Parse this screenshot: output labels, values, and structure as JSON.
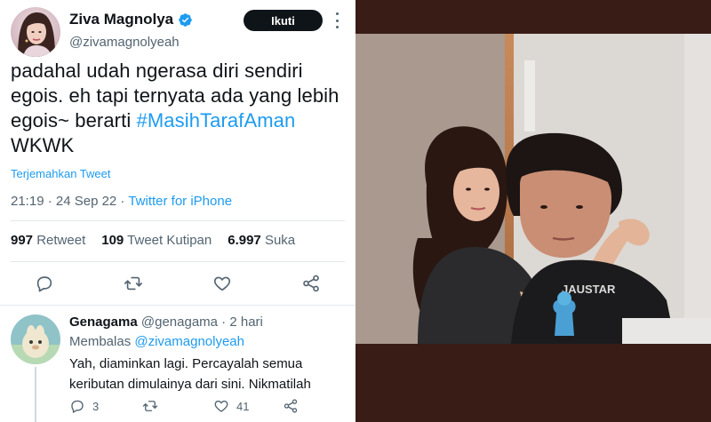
{
  "tweet": {
    "author": {
      "display_name": "Ziva Magnolya",
      "handle": "@zivamagnolyeah",
      "verified": true
    },
    "follow_label": "Ikuti",
    "text_parts": {
      "line1": "padahal udah ngerasa diri sendiri",
      "line2": "egois. eh tapi ternyata ada yang lebih",
      "line3_prefix": "egois~ berarti ",
      "hashtag": "#MasihTarafAman",
      "line4": "WKWK"
    },
    "translate_label": "Terjemahkan Tweet",
    "timestamp": "21:19 · 24 Sep 22 · ",
    "source": "Twitter for iPhone",
    "stats": {
      "retweets_count": "997",
      "retweets_label": "Retweet",
      "quotes_count": "109",
      "quotes_label": "Tweet Kutipan",
      "likes_count": "6.997",
      "likes_label": "Suka"
    },
    "actions": [
      "reply-icon",
      "retweet-icon",
      "like-icon",
      "share-icon"
    ]
  },
  "reply": {
    "display_name": "Genagama",
    "handle": "@genagama",
    "separator": " · ",
    "time": "2 hari",
    "replying_label": "Membalas ",
    "replying_to": "@zivamagnolyeah",
    "text": "Yah, diaminkan lagi. Percayalah semua keributan dimulainya dari sini. Nikmatilah",
    "reply_count": "3",
    "retweet_count": "",
    "like_count": "41"
  },
  "colors": {
    "accent": "#1d9bf0",
    "text_primary": "#0f1419",
    "text_secondary": "#536471",
    "follow_bg": "#0f1419",
    "photo_frame": "#3a1c17"
  }
}
